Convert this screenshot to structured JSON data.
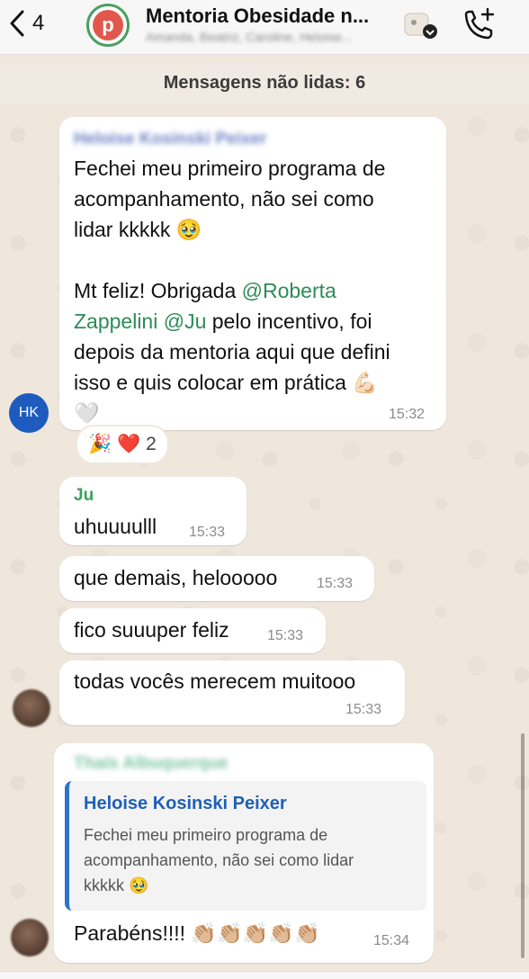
{
  "header": {
    "back_count": "4",
    "group_initial": "p",
    "title": "Mentoria Obesidade n...",
    "participants": "Amanda, Beatriz, Caroline, Heloise..."
  },
  "banner": {
    "unread": "Mensagens não lidas: 6"
  },
  "messages": [
    {
      "sender": "Heloise Kosinski Peixer",
      "avatar_initials": "HK",
      "p1_line1": "Fechei meu primeiro programa de",
      "p1_line2": "acompanhamento, não sei como",
      "p1_line3": "lidar kkkkk 🥹",
      "p2_pre": "Mt feliz! Obrigada ",
      "mention_roberta_1": "@Roberta",
      "mention_roberta_2": "Zappelini",
      "mention_ju": "@Ju",
      "p2_line2_rest": " pelo incentivo, foi",
      "p2_line3": "depois da mentoria aqui que defini",
      "p2_line4": "isso e quis colocar em prática 💪🏻",
      "p2_line5": "🤍",
      "time": "15:32",
      "reactions": {
        "emojis": "🎉 ❤️",
        "count": "2"
      }
    },
    {
      "sender": "Ju",
      "text": "uhuuuulll",
      "time": "15:33"
    },
    {
      "text": "que demais, helooooo",
      "time": "15:33"
    },
    {
      "text": "fico suuuper feliz",
      "time": "15:33"
    },
    {
      "text": "todas vocês merecem muitooo",
      "time": "15:33"
    },
    {
      "sender": "Thaís Albuquerque",
      "quote": {
        "name": "Heloise Kosinski Peixer",
        "line1": "Fechei meu primeiro programa de",
        "line2": "acompanhamento, não sei como lidar",
        "line3": "kkkkk 🥹"
      },
      "text": "Parabéns!!!! 👏🏼👏🏼👏🏼👏🏼👏🏼",
      "time": "15:34"
    }
  ],
  "colors": {
    "ju_name": "#3aa35a",
    "heloise_name": "#6e86c7",
    "thais_name": "#7fc7a7",
    "mention": "#2e8b57",
    "quote_accent": "#2f74c8",
    "avatar_hk": "#1d5bbf"
  }
}
